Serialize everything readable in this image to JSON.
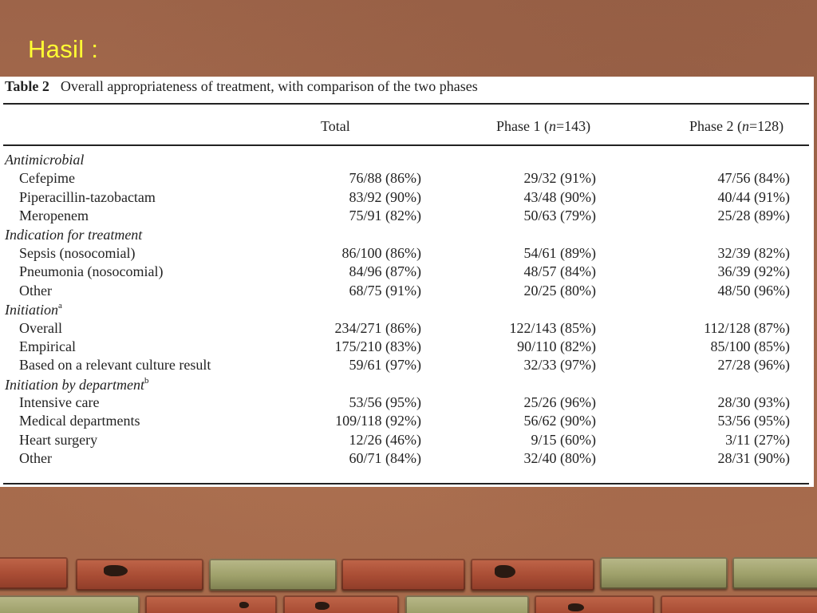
{
  "slide": {
    "title": "Hasil :"
  },
  "table": {
    "label": "Table 2",
    "caption": "Overall appropriateness of treatment, with comparison of the two phases",
    "columns": {
      "total": "Total",
      "phase1_prefix": "Phase 1 (",
      "phase1_n": "n",
      "phase1_suffix": "=143)",
      "phase2_prefix": "Phase 2 (",
      "phase2_n": "n",
      "phase2_suffix": "=128)"
    },
    "rows": [
      {
        "type": "section",
        "label": "Antimicrobial",
        "sup": ""
      },
      {
        "type": "item",
        "label": "Cefepime",
        "total": "76/88 (86%)",
        "p1": "29/32 (91%)",
        "p2": "47/56 (84%)"
      },
      {
        "type": "item",
        "label": "Piperacillin-tazobactam",
        "total": "83/92 (90%)",
        "p1": "43/48 (90%)",
        "p2": "40/44 (91%)"
      },
      {
        "type": "item",
        "label": "Meropenem",
        "total": "75/91 (82%)",
        "p1": "50/63 (79%)",
        "p2": "25/28 (89%)"
      },
      {
        "type": "section",
        "label": "Indication for treatment",
        "sup": ""
      },
      {
        "type": "item",
        "label": "Sepsis (nosocomial)",
        "total": "86/100 (86%)",
        "p1": "54/61 (89%)",
        "p2": "32/39 (82%)"
      },
      {
        "type": "item",
        "label": "Pneumonia (nosocomial)",
        "total": "84/96 (87%)",
        "p1": "48/57 (84%)",
        "p2": "36/39 (92%)"
      },
      {
        "type": "item",
        "label": "Other",
        "total": "68/75 (91%)",
        "p1": "20/25 (80%)",
        "p2": "48/50 (96%)"
      },
      {
        "type": "section",
        "label": "Initiation",
        "sup": "a"
      },
      {
        "type": "item",
        "label": "Overall",
        "total": "234/271 (86%)",
        "p1": "122/143 (85%)",
        "p2": "112/128 (87%)"
      },
      {
        "type": "item",
        "label": "Empirical",
        "total": "175/210 (83%)",
        "p1": "90/110 (82%)",
        "p2": "85/100 (85%)"
      },
      {
        "type": "item",
        "label": "Based on a relevant culture result",
        "total": "59/61 (97%)",
        "p1": "32/33 (97%)",
        "p2": "27/28 (96%)"
      },
      {
        "type": "section",
        "label": "Initiation by department",
        "sup": "b"
      },
      {
        "type": "item",
        "label": "Intensive care",
        "total": "53/56 (95%)",
        "p1": "25/26 (96%)",
        "p2": "28/30 (93%)"
      },
      {
        "type": "item",
        "label": "Medical departments",
        "total": "109/118 (92%)",
        "p1": "56/62 (90%)",
        "p2": "53/56 (95%)"
      },
      {
        "type": "item",
        "label": "Heart surgery",
        "total": "12/26 (46%)",
        "p1": "9/15 (60%)",
        "p2": "3/11 (27%)"
      },
      {
        "type": "item",
        "label": "Other",
        "total": "60/71 (84%)",
        "p1": "32/40 (80%)",
        "p2": "28/31 (90%)"
      }
    ]
  },
  "colors": {
    "background": "#a46a4c",
    "title": "#ffff33",
    "panel": "#ffffff",
    "text": "#222222"
  }
}
